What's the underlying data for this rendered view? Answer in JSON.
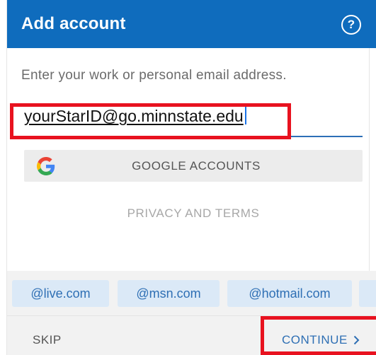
{
  "header": {
    "title": "Add account",
    "help_icon": "question-circle-icon",
    "help_glyph": "?",
    "background_color": "#0f6cbd"
  },
  "prompt": "Enter your work or personal email address.",
  "email_input": {
    "value": "yourStarID@go.minnstate.edu"
  },
  "google_button": {
    "label": "GOOGLE ACCOUNTS",
    "icon": "google-g-icon"
  },
  "privacy_link": "PRIVACY AND TERMS",
  "domain_chips": [
    "@live.com",
    "@msn.com",
    "@hotmail.com"
  ],
  "footer": {
    "skip_label": "SKIP",
    "continue_label": "CONTINUE",
    "continue_icon": "chevron-right-icon"
  },
  "colors": {
    "accent": "#2e6fb4",
    "highlight": "#e8121f",
    "chip_background": "#dbe9f7"
  }
}
